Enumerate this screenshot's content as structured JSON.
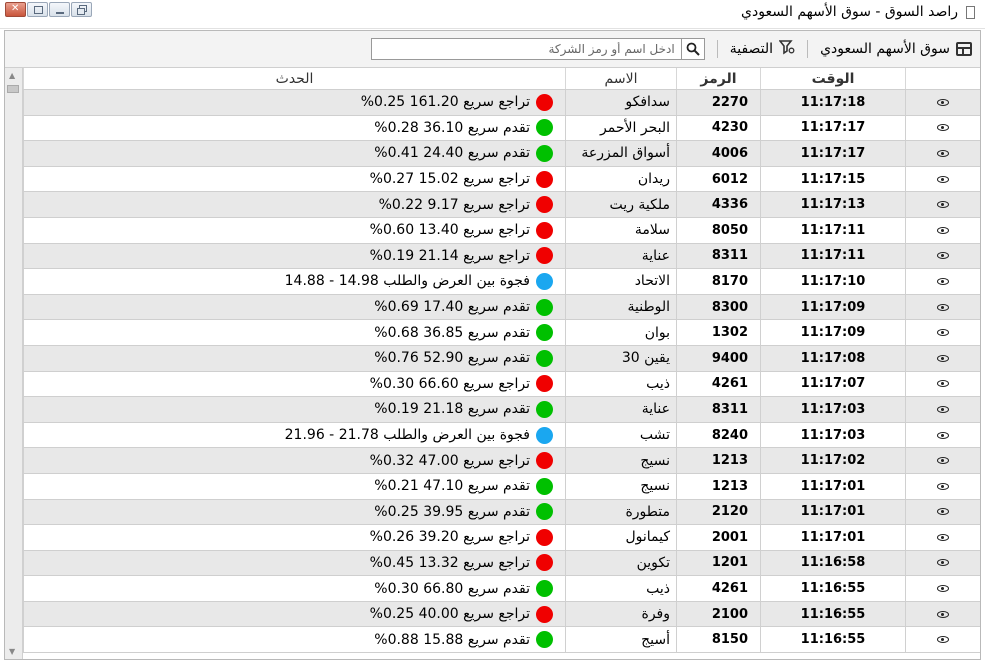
{
  "window": {
    "title": "راصد  السوق - سوق الأسهم السعودي"
  },
  "toolbar": {
    "market_label": "سوق الأسهم السعودي",
    "filter_label": "التصفية",
    "search_placeholder": "ادخل اسم أو رمز الشركة"
  },
  "table": {
    "columns": {
      "time": "الوقت",
      "symbol": "الرمز",
      "name": "الاسم",
      "event": "الحدث"
    },
    "status_colors": {
      "down": "#f00000",
      "up": "#00c000",
      "gap": "#1aa7f0"
    },
    "rows": [
      {
        "time": "11:17:18",
        "symbol": "2270",
        "name": "سدافكو",
        "event": "تراجع سريع  161.20  0.25%",
        "status": "down"
      },
      {
        "time": "11:17:17",
        "symbol": "4230",
        "name": "البحر الأحمر",
        "event": "تقدم سريع  36.10  0.28%",
        "status": "up"
      },
      {
        "time": "11:17:17",
        "symbol": "4006",
        "name": "أسواق المزرعة",
        "event": "تقدم سريع  24.40  0.41%",
        "status": "up"
      },
      {
        "time": "11:17:15",
        "symbol": "6012",
        "name": "ريدان",
        "event": "تراجع سريع  15.02  0.27%",
        "status": "down"
      },
      {
        "time": "11:17:13",
        "symbol": "4336",
        "name": "ملكية ريت",
        "event": "تراجع سريع  9.17  0.22%",
        "status": "down"
      },
      {
        "time": "11:17:11",
        "symbol": "8050",
        "name": "سلامة",
        "event": "تراجع سريع  13.40  0.60%",
        "status": "down"
      },
      {
        "time": "11:17:11",
        "symbol": "8311",
        "name": "عناية",
        "event": "تراجع سريع  21.14  0.19%",
        "status": "down"
      },
      {
        "time": "11:17:10",
        "symbol": "8170",
        "name": "الاتحاد",
        "event": "فجوة بين العرض والطلب 14.98 - 14.88",
        "status": "gap"
      },
      {
        "time": "11:17:09",
        "symbol": "8300",
        "name": "الوطنية",
        "event": "تقدم سريع  17.40  0.69%",
        "status": "up"
      },
      {
        "time": "11:17:09",
        "symbol": "1302",
        "name": "بوان",
        "event": "تقدم سريع  36.85  0.68%",
        "status": "up"
      },
      {
        "time": "11:17:08",
        "symbol": "9400",
        "name": "يقين 30",
        "event": "تقدم سريع  52.90  0.76%",
        "status": "up"
      },
      {
        "time": "11:17:07",
        "symbol": "4261",
        "name": "ذيب",
        "event": "تراجع سريع  66.60  0.30%",
        "status": "down"
      },
      {
        "time": "11:17:03",
        "symbol": "8311",
        "name": "عناية",
        "event": "تقدم سريع  21.18  0.19%",
        "status": "up"
      },
      {
        "time": "11:17:03",
        "symbol": "8240",
        "name": "تشب",
        "event": "فجوة بين العرض والطلب 21.78 - 21.96",
        "status": "gap"
      },
      {
        "time": "11:17:02",
        "symbol": "1213",
        "name": "نسيج",
        "event": "تراجع سريع  47.00  0.32%",
        "status": "down"
      },
      {
        "time": "11:17:01",
        "symbol": "1213",
        "name": "نسيج",
        "event": "تقدم سريع  47.10  0.21%",
        "status": "up"
      },
      {
        "time": "11:17:01",
        "symbol": "2120",
        "name": "متطورة",
        "event": "تقدم سريع  39.95  0.25%",
        "status": "up"
      },
      {
        "time": "11:17:01",
        "symbol": "2001",
        "name": "كيمانول",
        "event": "تراجع سريع  39.20  0.26%",
        "status": "down"
      },
      {
        "time": "11:16:58",
        "symbol": "1201",
        "name": "تكوين",
        "event": "تراجع سريع  13.32  0.45%",
        "status": "down"
      },
      {
        "time": "11:16:55",
        "symbol": "4261",
        "name": "ذيب",
        "event": "تقدم سريع  66.80  0.30%",
        "status": "up"
      },
      {
        "time": "11:16:55",
        "symbol": "2100",
        "name": "وفرة",
        "event": "تراجع سريع  40.00  0.25%",
        "status": "down"
      },
      {
        "time": "11:16:55",
        "symbol": "8150",
        "name": "أسيج",
        "event": "تقدم سريع  15.88  0.88%",
        "status": "up"
      }
    ]
  }
}
